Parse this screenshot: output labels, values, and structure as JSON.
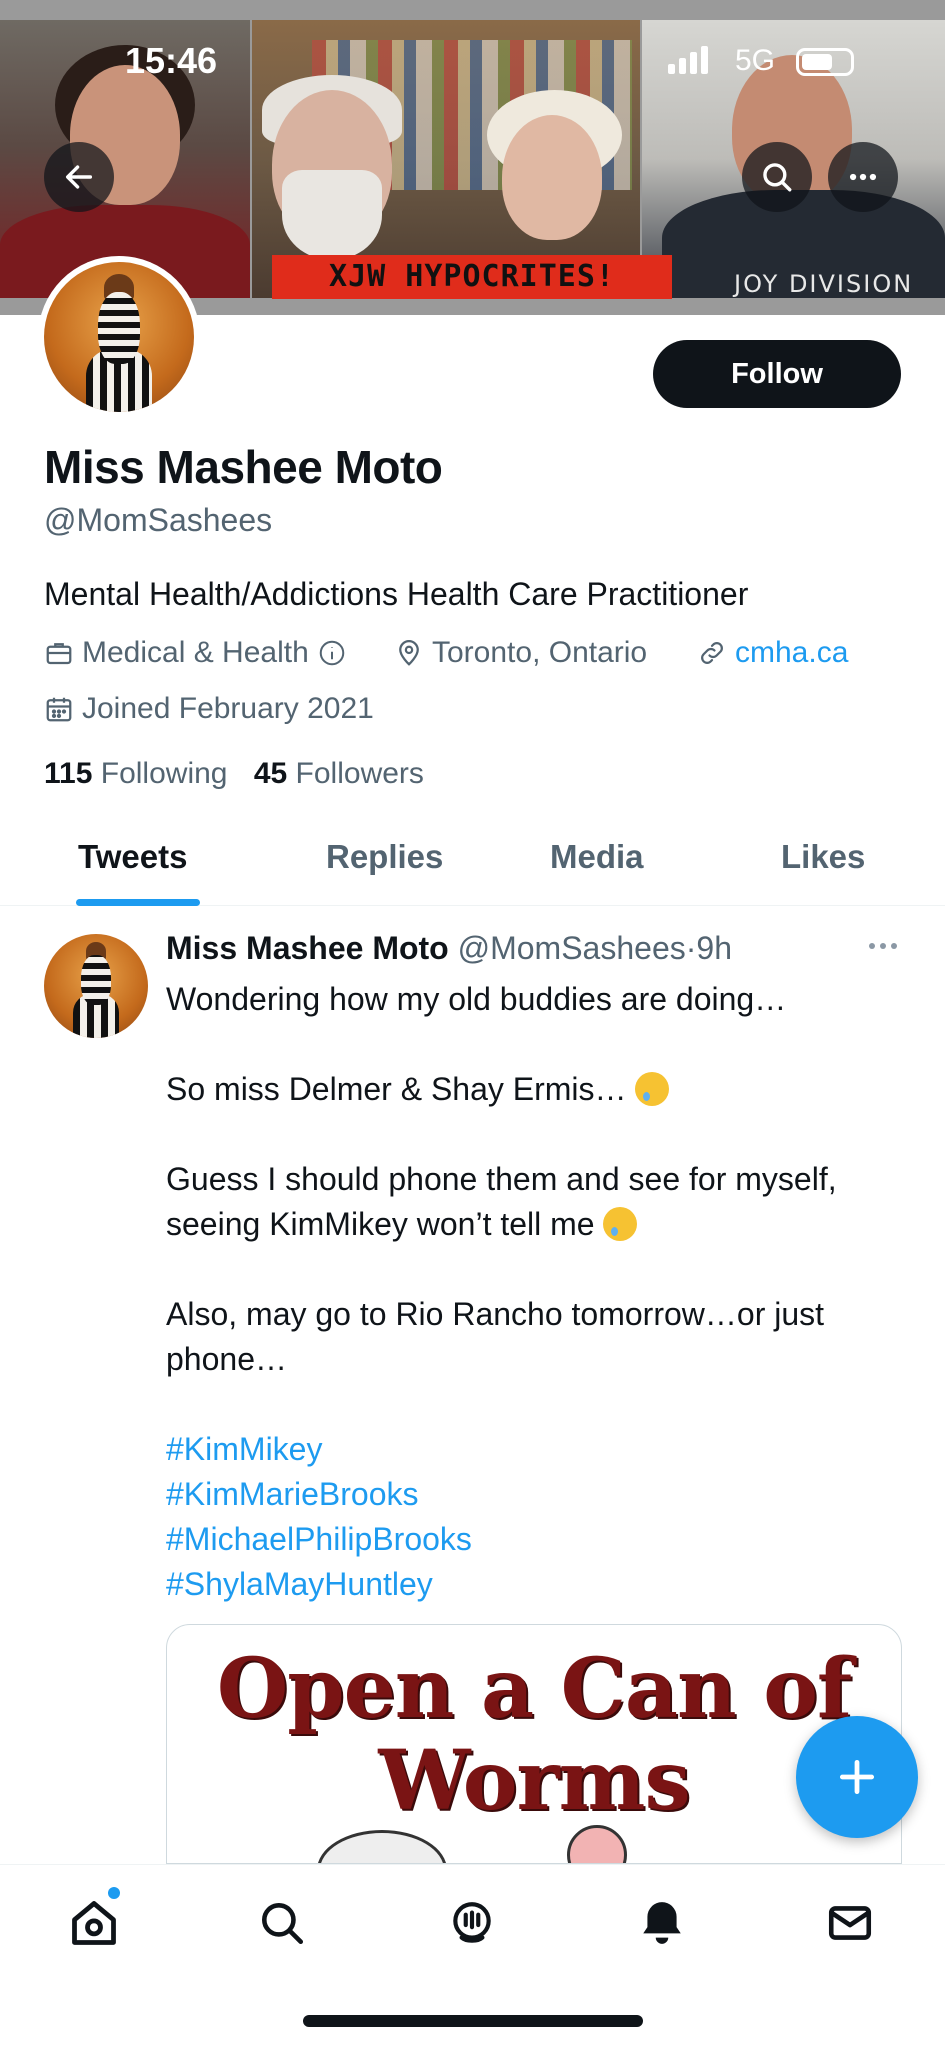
{
  "status_bar": {
    "time": "15:46",
    "network": "5G"
  },
  "banner": {
    "caption": "XJW HYPOCRITES!",
    "shirt_text": "JOY DIVISION"
  },
  "profile": {
    "follow_label": "Follow",
    "display_name": "Miss Mashee Moto",
    "handle": "@MomSashees",
    "bio": "Mental Health/Addictions Health Care Practitioner",
    "category": "Medical & Health",
    "location": "Toronto, Ontario",
    "website": "cmha.ca",
    "joined": "Joined February 2021",
    "following_count": "115",
    "following_label": "Following",
    "followers_count": "45",
    "followers_label": "Followers"
  },
  "tabs": [
    {
      "label": "Tweets",
      "active": true
    },
    {
      "label": "Replies"
    },
    {
      "label": "Media"
    },
    {
      "label": "Likes"
    }
  ],
  "tweet": {
    "author_name": "Miss Mashee Moto",
    "author_handle": "@MomSashees",
    "separator": "·",
    "time": "9h",
    "lines": {
      "l1": "Wondering how my old buddies are doing…",
      "l2": "So miss Delmer & Shay Ermis…",
      "l3a": "Guess I should phone them and see for myself,",
      "l3b": "seeing KimMikey won’t tell me",
      "l4a": "Also, may go to Rio Rancho tomorrow…or just",
      "l4b": "phone…"
    },
    "hashtags": [
      "#KimMikey",
      "#KimMarieBrooks",
      "#MichaelPhilipBrooks",
      "#ShylaMayHuntley"
    ],
    "media_title_1": "Open a Can of",
    "media_title_2": "Worms"
  },
  "colors": {
    "accent": "#1d9bf0",
    "text": "#0f1419",
    "secondary": "#536471",
    "caption_red": "#e02c1b"
  },
  "icons": [
    "back-arrow-icon",
    "search-icon",
    "more-icon",
    "briefcase-icon",
    "info-icon",
    "location-pin-icon",
    "link-icon",
    "calendar-icon",
    "compose-plus-icon",
    "home-icon",
    "explore-search-icon",
    "spaces-icon",
    "notifications-bell-icon",
    "messages-envelope-icon"
  ]
}
